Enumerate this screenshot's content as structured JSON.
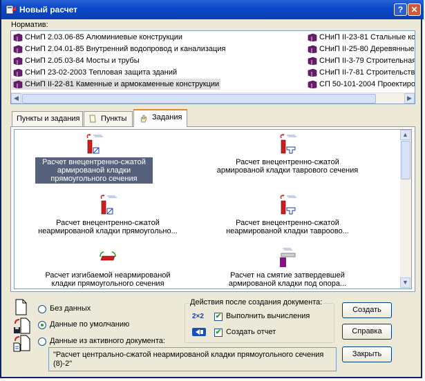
{
  "window": {
    "title": "Новый расчет",
    "help_button": "?",
    "close_button": "✕"
  },
  "normative": {
    "label": "Норматив:",
    "items_left": [
      "СНиП 2.03.06-85 Алюминиевые конструкции",
      "СНиП 2.04.01-85 Внутренний водопровод и канализация",
      "СНиП 2.05.03-84 Мосты и трубы",
      "СНиП 23-02-2003 Тепловая защита зданий",
      "СНиП II-22-81 Каменные и армокаменные конструкции"
    ],
    "items_right": [
      "СНиП II-23-81 Стальные кон",
      "СНиП II-25-80 Деревянные",
      "СНиП II-3-79 Строительная",
      "СНиП II-7-81 Строительство",
      "СП 50-101-2004 Проектиров"
    ],
    "selected_index": 4
  },
  "tabs": [
    "Пункты и задания",
    "Пункты",
    "Задания"
  ],
  "active_tab": 2,
  "tasks": [
    {
      "label": "Расчет внецентренно-сжатой армированой кладки прямоугольного сечения",
      "icon": "eccentric-rect-reinforced-icon",
      "selected": true
    },
    {
      "label": "Расчет внецентренно-сжатой армированой кладки таврового сечения",
      "icon": "eccentric-tee-reinforced-icon"
    },
    {
      "label": "Расчет внецентренно-сжатой неармированой кладки прямоугольно...",
      "icon": "eccentric-rect-plain-icon"
    },
    {
      "label": "Расчет внецентренно-сжатой неармированой кладки тавроово...",
      "icon": "eccentric-tee-plain-icon"
    },
    {
      "label": "Расчет изгибаемой неармированой кладки прямоугольного сечения",
      "icon": "bending-icon"
    },
    {
      "label": "Расчет на смятие затвердевшей армированой кладки под опора...",
      "icon": "bearing-icon"
    }
  ],
  "source": {
    "options": [
      "Без данных",
      "Данные по умолчанию",
      "Данные из активного документа:"
    ],
    "selected_index": 1,
    "document_text": "\"Расчет центрально-сжатой неармированой кладки прямоугольного сечения (8)-2\""
  },
  "actions": {
    "legend": "Действия после создания документа:",
    "items": [
      {
        "label": "Выполнить вычисления",
        "checked": true,
        "icon": "calculate-icon",
        "icon_text": "2×2"
      },
      {
        "label": "Создать отчет",
        "checked": true,
        "icon": "report-icon"
      }
    ]
  },
  "buttons": {
    "create": "Создать",
    "help": "Справка",
    "close": "Закрыть"
  },
  "colors": {
    "titlebar": "#0b48c9",
    "selection": "#56627b",
    "tab_highlight": "#e68b2c",
    "book": "#6a1b6e"
  }
}
